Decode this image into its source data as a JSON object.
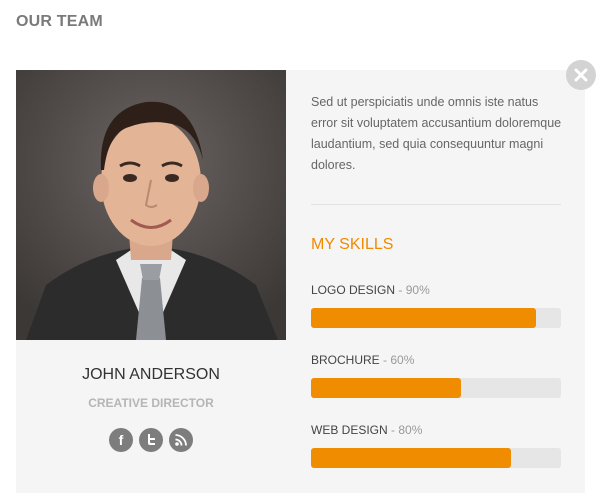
{
  "section": {
    "title": "OUR TEAM"
  },
  "member": {
    "name": "JOHN ANDERSON",
    "role": "CREATIVE DIRECTOR",
    "bio": "Sed ut perspiciatis unde omnis iste natus error sit voluptatem accusantium doloremque laudantium, sed quia consequuntur magni dolores."
  },
  "social": [
    {
      "icon": "facebook-icon",
      "glyph": "f"
    },
    {
      "icon": "twitter-icon",
      "glyph": "t"
    },
    {
      "icon": "rss-icon",
      "glyph": "rss"
    }
  ],
  "skills": {
    "title": "MY SKILLS",
    "items": [
      {
        "label": "LOGO DESIGN",
        "percent_text": "90%",
        "value": 0.9
      },
      {
        "label": "BROCHURE",
        "percent_text": "60%",
        "value": 0.6
      },
      {
        "label": "WEB DESIGN",
        "percent_text": "80%",
        "value": 0.8
      }
    ]
  },
  "colors": {
    "accent": "#f08c00",
    "track": "#e6e6e6",
    "card_bg": "#f5f5f5"
  }
}
